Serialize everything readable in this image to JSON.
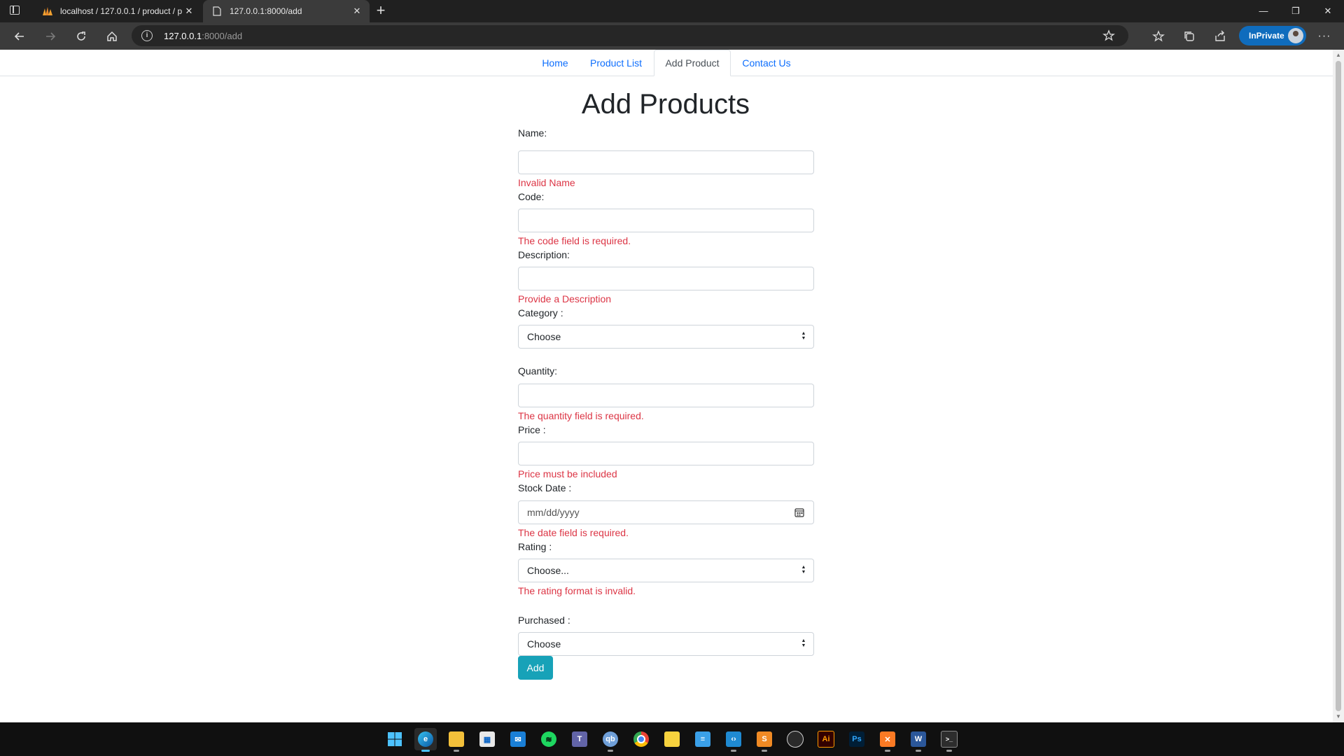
{
  "browser": {
    "tabs": [
      {
        "title": "localhost / 127.0.0.1 / product / p",
        "icon": "phpmyadmin-icon",
        "active": false
      },
      {
        "title": "127.0.0.1:8000/add",
        "icon": "page-icon",
        "active": true
      }
    ],
    "url_host": "127.0.0.1",
    "url_path": ":8000/add",
    "inprivate_label": "InPrivate"
  },
  "nav": {
    "items": [
      {
        "label": "Home",
        "active": false
      },
      {
        "label": "Product List",
        "active": false
      },
      {
        "label": "Add Product",
        "active": true
      },
      {
        "label": "Contact Us",
        "active": false
      }
    ]
  },
  "form": {
    "title": "Add Products",
    "name_label": "Name:",
    "name_error": "Invalid Name",
    "code_label": "Code:",
    "code_error": "The code field is required.",
    "description_label": "Description:",
    "description_error": "Provide a Description",
    "category_label": "Category :",
    "category_value": "Choose",
    "quantity_label": "Quantity:",
    "quantity_error": "The quantity field is required.",
    "price_label": "Price :",
    "price_error": "Price must be included",
    "stock_date_label": "Stock Date :",
    "stock_date_placeholder": "mm/dd/yyyy",
    "stock_date_error": "The date field is required.",
    "rating_label": "Rating :",
    "rating_value": "Choose...",
    "rating_error": "The rating format is invalid.",
    "purchased_label": "Purchased :",
    "purchased_value": "Choose",
    "submit_label": "Add"
  },
  "colors": {
    "error": "#dc3545",
    "link": "#0d6efd",
    "button": "#17a2b8",
    "browser_accent": "#0f6cbd"
  },
  "taskbar": {
    "apps": [
      "windows-start-icon",
      "edge-icon",
      "file-explorer-icon",
      "microsoft-store-icon",
      "mail-icon",
      "spotify-icon",
      "teams-icon",
      "qbittorrent-icon",
      "chrome-icon",
      "sticky-notes-icon",
      "notepad-icon",
      "vscode-icon",
      "sublime-text-icon",
      "obs-icon",
      "illustrator-icon",
      "photoshop-icon",
      "xampp-icon",
      "word-icon",
      "terminal-icon"
    ]
  }
}
